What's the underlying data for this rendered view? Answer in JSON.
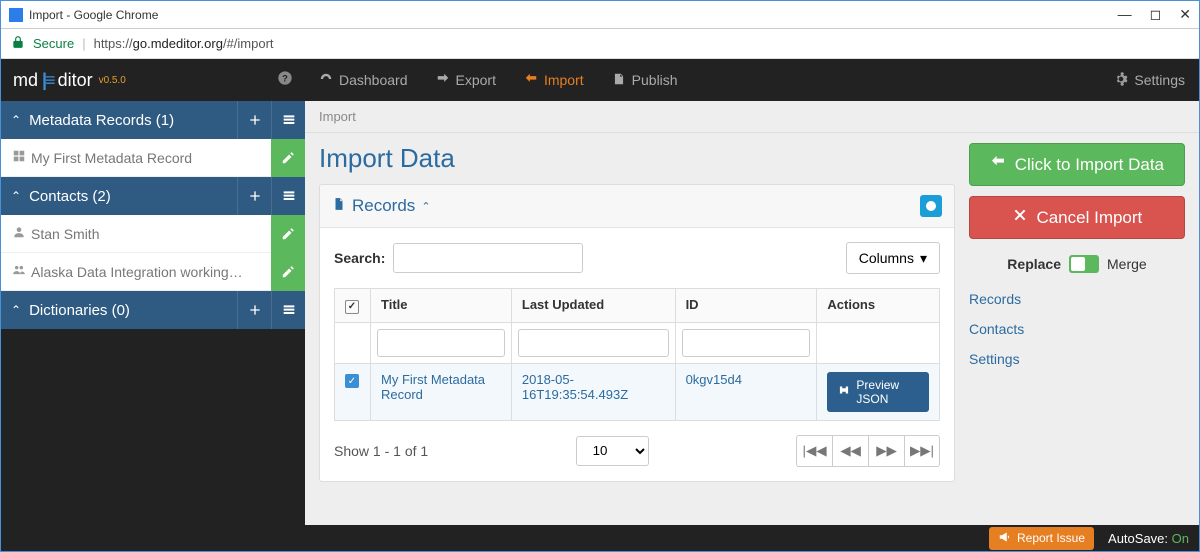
{
  "window": {
    "title": "Import - Google Chrome"
  },
  "addressbar": {
    "secure": "Secure",
    "url_prefix": "https://",
    "url_host": "go.mdeditor.org",
    "url_path": "/#/import"
  },
  "logo": {
    "md": "md",
    "ditor": "ditor",
    "version": "v0.5.0"
  },
  "nav": {
    "dashboard": "Dashboard",
    "export": "Export",
    "import": "Import",
    "publish": "Publish",
    "settings": "Settings"
  },
  "sidebar": {
    "sections": [
      {
        "label": "Metadata Records (1)",
        "items": [
          {
            "label": "My First Metadata Record"
          }
        ]
      },
      {
        "label": "Contacts (2)",
        "items": [
          {
            "label": "Stan Smith"
          },
          {
            "label": "Alaska Data Integration working…"
          }
        ]
      },
      {
        "label": "Dictionaries (0)",
        "items": []
      }
    ]
  },
  "breadcrumb": "Import",
  "page": {
    "title": "Import Data"
  },
  "panel": {
    "title": "Records",
    "search_label": "Search:",
    "columns_label": "Columns",
    "columns": {
      "title": "Title",
      "last_updated": "Last Updated",
      "id": "ID",
      "actions": "Actions"
    },
    "rows": [
      {
        "title": "My First Metadata Record",
        "last_updated": "2018-05-16T19:35:54.493Z",
        "id": "0kgv15d4"
      }
    ],
    "preview_label": "Preview JSON",
    "show_text": "Show 1 - 1 of 1",
    "page_size": "10"
  },
  "actions": {
    "import_btn": "Click to Import Data",
    "cancel_btn": "Cancel Import",
    "toggle_left": "Replace",
    "toggle_right": "Merge",
    "links": {
      "records": "Records",
      "contacts": "Contacts",
      "settings": "Settings"
    }
  },
  "footer": {
    "report": "Report Issue",
    "autosave_label": "AutoSave:",
    "autosave_state": "On"
  }
}
